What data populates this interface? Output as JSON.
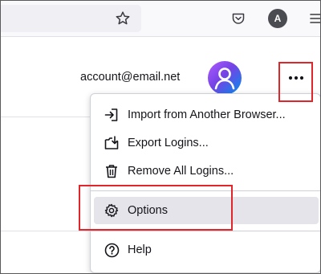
{
  "toolbar": {
    "account_initial": "A",
    "icons": [
      "star-icon",
      "pocket-icon",
      "account-icon",
      "hamburger-menu-icon"
    ]
  },
  "logins": {
    "account_email": "account@email.net"
  },
  "menu": {
    "items": [
      {
        "label": "Import from Another Browser...",
        "icon": "import-icon"
      },
      {
        "label": "Export Logins...",
        "icon": "export-icon"
      },
      {
        "label": "Remove All Logins...",
        "icon": "trash-icon"
      },
      {
        "label": "Options",
        "icon": "gear-icon"
      },
      {
        "label": "Help",
        "icon": "help-icon"
      }
    ]
  },
  "colors": {
    "highlight": "#e0252b",
    "selected_item_bg": "#e4e4ea"
  }
}
